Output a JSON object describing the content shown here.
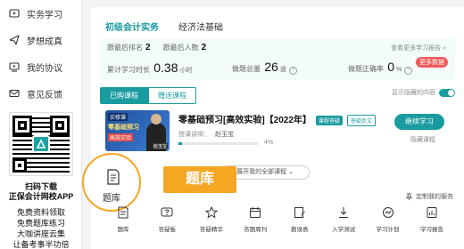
{
  "sidebar": {
    "items": [
      {
        "label": "实务学习",
        "icon": "play-icon"
      },
      {
        "label": "梦想成真",
        "icon": "send-icon"
      },
      {
        "label": "我的协议",
        "icon": "video-icon"
      },
      {
        "label": "意见反馈",
        "icon": "mail-icon"
      }
    ],
    "qr_caption_1": "扫码下载",
    "qr_caption_2": "正保会计网校APP",
    "promos": [
      "免费资料领取",
      "免费题库练习",
      "大咖讲座云集",
      "让备考事半功倍"
    ]
  },
  "tabs": [
    {
      "label": "初级会计实务",
      "active": true
    },
    {
      "label": "经济法基础",
      "active": false
    }
  ],
  "stats": {
    "row1": [
      {
        "label": "跟最后排名",
        "value": "2"
      },
      {
        "label": "跟最后人数",
        "value": "2"
      }
    ],
    "link": "查看更多学习报告 »",
    "study_time_label": "累计学习时长",
    "study_time_value": "0.38",
    "study_time_unit": "小时",
    "questions_label": "做题总量",
    "questions_value": "26",
    "questions_unit": "道",
    "accuracy_label": "做题正确率",
    "accuracy_value": "0",
    "accuracy_unit": "%",
    "badge": "更多数据"
  },
  "subtabs": [
    {
      "label": "已购课程",
      "active": true
    },
    {
      "label": "赠送课程",
      "active": false
    }
  ],
  "show_hidden_label": "显示隐藏的内容",
  "course": {
    "thumb_top": "实修课",
    "thumb_title": "零基础预习",
    "thumb_tag": "高效实验",
    "thumb_name": "赵玉宝",
    "title": "零基础预习[高效实验]【2022年】",
    "tag1": "课程答疑",
    "tag2": "答疑反文",
    "teacher_label": "授课讲师：",
    "teacher_name": "赵玉宝",
    "progress_pct": 4,
    "progress_text": "4%",
    "study_button": "继续学习",
    "back_link": "隐藏课程"
  },
  "expand_label": "展开我的全部课程",
  "custom_service": "定制我的服务",
  "callout": "题库",
  "highlight_tool": "题库",
  "tools": [
    {
      "label": "题库",
      "icon": "book-icon"
    },
    {
      "label": "答疑板",
      "icon": "question-icon"
    },
    {
      "label": "答疑精华",
      "icon": "star-icon"
    },
    {
      "label": "答题周刊",
      "icon": "calendar-icon"
    },
    {
      "label": "勘误表",
      "icon": "edit-icon"
    },
    {
      "label": "入学测试",
      "icon": "test-icon"
    },
    {
      "label": "学习计划",
      "icon": "plan-icon"
    },
    {
      "label": "学习报告",
      "icon": "report-icon"
    }
  ],
  "colors": {
    "accent": "#1a9ba0",
    "highlight": "#f5a623",
    "badge": "#f05a5a"
  }
}
